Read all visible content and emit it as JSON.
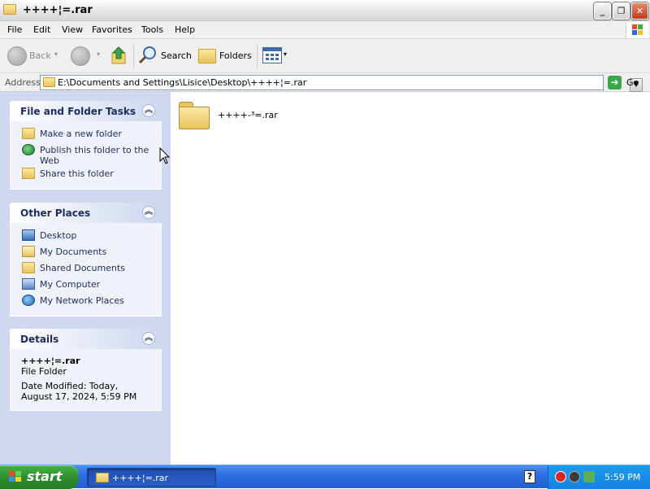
{
  "window": {
    "title": "++++¦=.rar",
    "controls": {
      "minimize": "_",
      "maximize": "❐",
      "close": "✕"
    }
  },
  "menubar": {
    "items": [
      "File",
      "Edit",
      "View",
      "Favorites",
      "Tools",
      "Help"
    ]
  },
  "toolbar": {
    "back": "Back",
    "search": "Search",
    "folders": "Folders"
  },
  "address": {
    "label": "Address",
    "value": "E:\\Documents and Settings\\Lisice\\Desktop\\++++¦=.rar",
    "go": "Go"
  },
  "taskpane": {
    "file_tasks": {
      "title": "File and Folder Tasks",
      "items": [
        "Make a new folder",
        "Publish this folder to the Web",
        "Share this folder"
      ]
    },
    "other_places": {
      "title": "Other Places",
      "items": [
        "Desktop",
        "My Documents",
        "Shared Documents",
        "My Computer",
        "My Network Places"
      ]
    },
    "details": {
      "title": "Details",
      "name": "++++¦=.rar",
      "type": "File Folder",
      "modified": "Date Modified: Today, August 17, 2024, 5:59 PM"
    }
  },
  "content": {
    "items": [
      {
        "name": "++++-³=.rar",
        "icon": "folder-icon"
      }
    ]
  },
  "taskbar": {
    "start": "start",
    "task_label": "++++¦=.rar",
    "clock": "5:59 PM"
  },
  "colors": {
    "taskbar": "#245edb",
    "start": "#2f8f2f",
    "tray": "#1490e6",
    "pane": "#cfd8ef"
  }
}
